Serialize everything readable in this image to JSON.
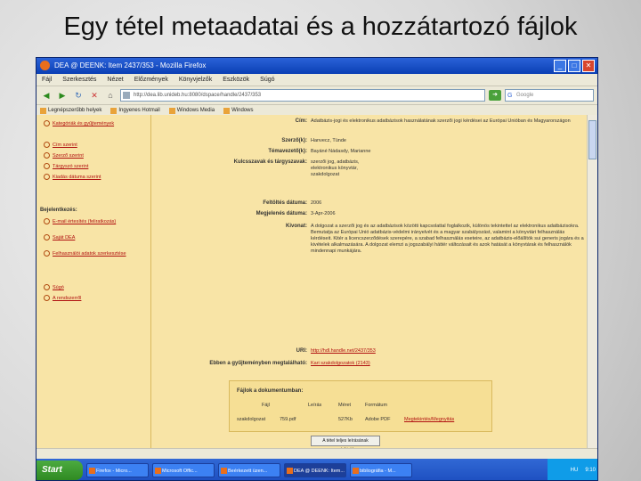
{
  "slide": {
    "title": "Egy tétel metaadatai és a hozzátartozó fájlok"
  },
  "window": {
    "title": "DEA @ DEENK: Item 2437/353 - Mozilla Firefox",
    "menu": [
      "Fájl",
      "Szerkesztés",
      "Nézet",
      "Előzmények",
      "Könyvjelzők",
      "Eszközök",
      "Súgó"
    ],
    "url": "http://dea.lib.unideb.hu:8080/dspace/handle/2437/353",
    "search_placeholder": "Google",
    "bookmarks": [
      "Legnépszerűbb helyek",
      "Ingyenes Hotmail",
      "Windows Media",
      "Windows"
    ]
  },
  "sidebar": {
    "top_items": [
      "Kategóriák és gyűjtemények",
      "Cím szerint",
      "Szerző szerint",
      "Tárgyszó szerint",
      "Kiadás dátuma szerint"
    ],
    "section_title": "Bejelentkezés:",
    "login_items": [
      "E-mail értesítés (feliratkozás)",
      "Saját DEA",
      "Felhasználói adatok szerkesztése"
    ],
    "bottom_items": [
      "Súgó",
      "A rendszerről"
    ]
  },
  "metadata": {
    "rows": [
      {
        "label": "Cím:",
        "value": "Adatbázis-jogi és elektronikus adatbázisok használatának szerzői jogi kérdései az Európai Unióban és Magyarországon"
      },
      {
        "label": "Szerző(k):",
        "value": "Hanvecz, Tünde"
      },
      {
        "label": "Témavezető(k):",
        "value": "Bayáné Nádasdy, Marianne"
      },
      {
        "label": "Kulcsszavak és tárgyszavak:",
        "value": "szerzői jog, adatbázis, elektronikus könyvtár, szakdolgozat"
      },
      {
        "label": "Feltöltés dátuma:",
        "value": "2006"
      },
      {
        "label": "Megjelenés dátuma:",
        "value": "3-Apr-2006"
      },
      {
        "label": "Kivonat:",
        "value": "A dolgozat a szerzői jog és az adatbázisok közötti kapcsolattal foglalkozik, különös tekintettel az elektronikus adatbázisokra. Bemutatja az Európai Unió adatbázis-védelmi irányelvét és a magyar szabályozást, valamint a könyvtári felhasználás kérdéseit. Kitér a licencszerződések szerepére, a szabad felhasználás eseteire, az adatbázis-előállítók sui generis jogára és a kivételek alkalmazására. A dolgozat elemzi a jogszabályi háttér változásait és azok hatását a könyvtárak és felhasználók mindennapi munkájára."
      },
      {
        "label": "URI:",
        "value": "http://hdl.handle.net/2437/353",
        "link": true
      },
      {
        "label": "Ebben a gyűjteményben megtalálható:",
        "value": "Kari szakdolgozatok (2143)",
        "link": true
      }
    ]
  },
  "files": {
    "title": "Fájlok a dokumentumban:",
    "headers": [
      "Fájl",
      "Leírás",
      "Méret",
      "Formátum"
    ],
    "rows": [
      {
        "file": "szakdolgozat",
        "description": "759.pdf",
        "size": "527Kb",
        "format": "Adobe PDF",
        "action": "Megtekintés/Megnyitás"
      }
    ],
    "show_all_label": "A tétel teljes leírásának megtekintése"
  },
  "taskbar": {
    "start_label": "Start",
    "tasks": [
      "Firefox - Micro...",
      "Microsoft Offic...",
      "Beérkezett üzen...",
      "DEA @ DEENK: Item...",
      "bibliográfia - M..."
    ],
    "tray_lang": "HU",
    "clock": "9:10"
  }
}
